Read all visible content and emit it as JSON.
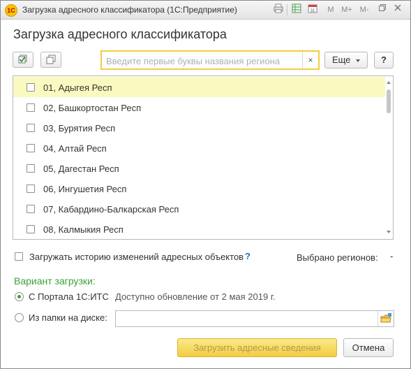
{
  "window": {
    "title": "Загрузка адресного классификатора  (1С:Предприятие)",
    "logo_text": "1С",
    "titlebar_buttons": [
      "M",
      "M+",
      "M-"
    ]
  },
  "heading": "Загрузка адресного классификатора",
  "toolbar": {
    "search_placeholder": "Введите первые буквы названия региона",
    "search_value": "",
    "clear_glyph": "×",
    "more_label": "Еще",
    "help_label": "?"
  },
  "regions": [
    {
      "label": "01, Адыгея Респ",
      "checked": false,
      "selected": true
    },
    {
      "label": "02, Башкортостан Респ",
      "checked": false,
      "selected": false
    },
    {
      "label": "03, Бурятия Респ",
      "checked": false,
      "selected": false
    },
    {
      "label": "04, Алтай Респ",
      "checked": false,
      "selected": false
    },
    {
      "label": "05, Дагестан Респ",
      "checked": false,
      "selected": false
    },
    {
      "label": "06, Ингушетия Респ",
      "checked": false,
      "selected": false
    },
    {
      "label": "07, Кабардино-Балкарская Респ",
      "checked": false,
      "selected": false
    },
    {
      "label": "08, Калмыкия Респ",
      "checked": false,
      "selected": false
    }
  ],
  "history": {
    "label": "Загружать историю изменений адресных объектов",
    "help": "?",
    "checked": false
  },
  "selected_regions": {
    "label": "Выбрано регионов:",
    "value": "-"
  },
  "variant": {
    "title": "Вариант загрузки:",
    "portal_label": "С Портала 1С:ИТС",
    "portal_selected": true,
    "update_note": "Доступно обновление от 2 мая 2019 г.",
    "folder_label": "Из папки на диске:",
    "folder_value": ""
  },
  "buttons": {
    "load": "Загрузить адресные сведения",
    "cancel": "Отмена"
  },
  "colors": {
    "accent_yellow": "#f3cd41",
    "selected_row": "#fafac0",
    "green": "#3aa03a",
    "help_blue": "#1a6fbf"
  }
}
